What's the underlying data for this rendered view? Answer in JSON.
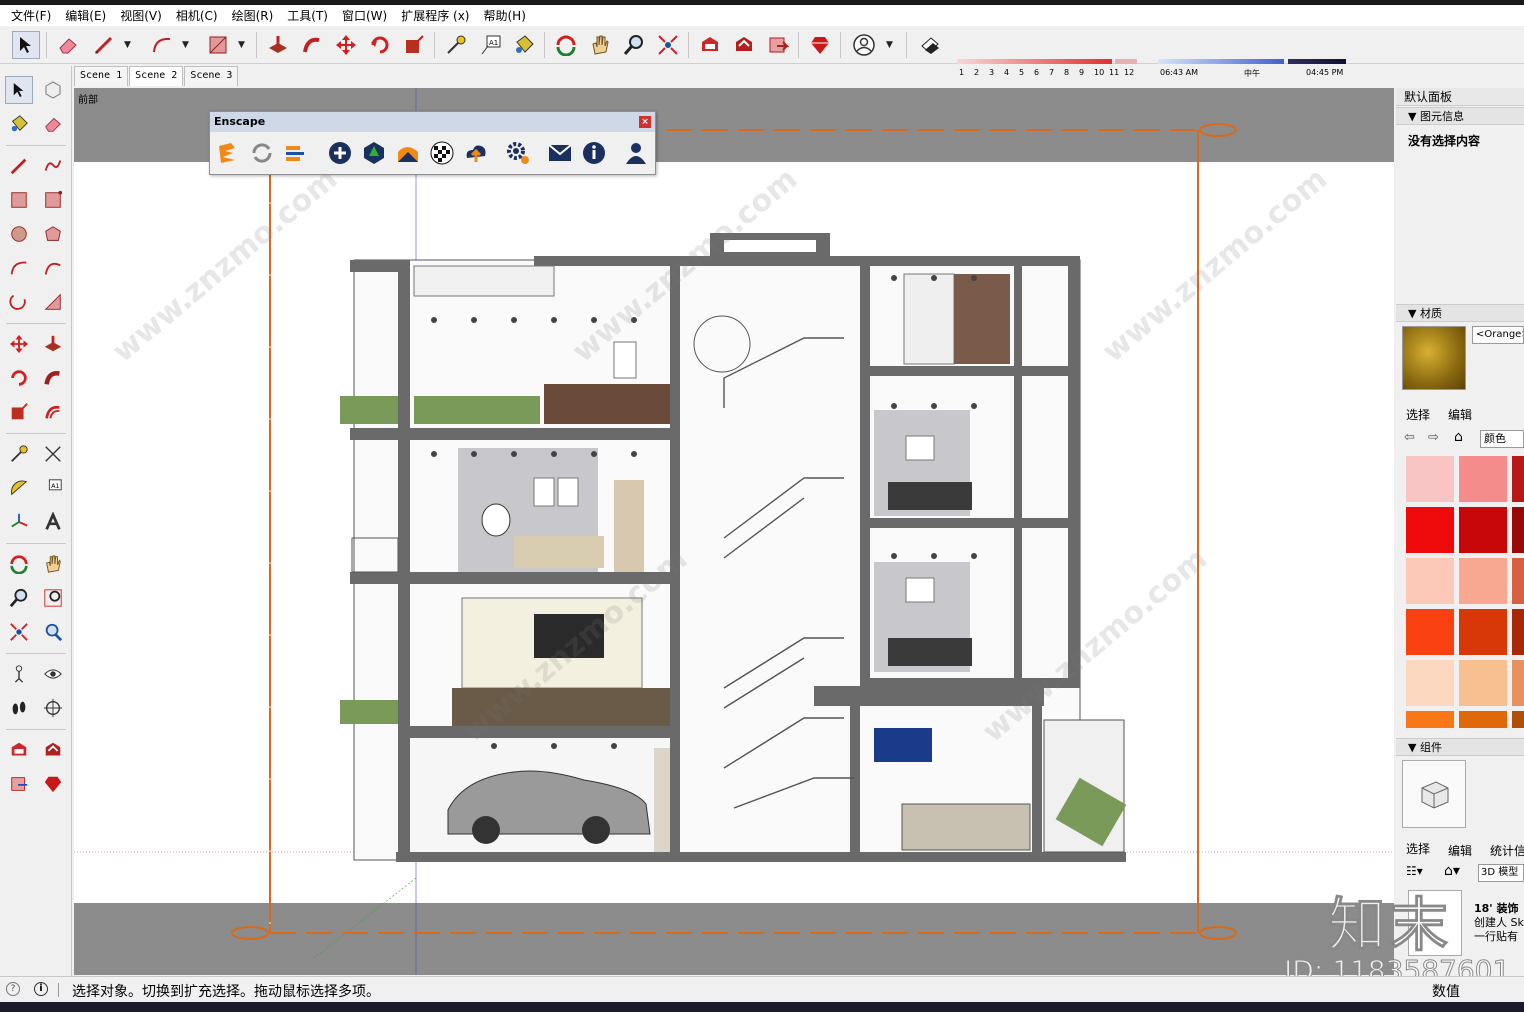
{
  "menu": [
    "文件(F)",
    "编辑(E)",
    "视图(V)",
    "相机(C)",
    "绘图(R)",
    "工具(T)",
    "窗口(W)",
    "扩展程序 (x)",
    "帮助(H)"
  ],
  "shadow": {
    "months": [
      "1",
      "2",
      "3",
      "4",
      "5",
      "6",
      "7",
      "8",
      "9",
      "10",
      "11",
      "12"
    ],
    "time_start": "06:43 AM",
    "time_mid": "中午",
    "time_end": "04:45 PM"
  },
  "scenes": [
    "Scene 1",
    "Scene 2",
    "Scene 3"
  ],
  "active_scene": "Scene 2",
  "view_label": "前部",
  "enscape": {
    "title": "Enscape"
  },
  "right_panel": {
    "default_tray": "默认面板",
    "entity_info": "图元信息",
    "no_selection": "没有选择内容",
    "materials": "材质",
    "material_name": "<Orange>",
    "select_tab": "选择",
    "edit_tab": "编辑",
    "color_dropdown": "颜色",
    "components": "组件",
    "comp_select": "选择",
    "comp_edit": "编辑",
    "comp_stats": "统计信",
    "comp_model": "3D 模型",
    "comp_item_title": "18' 装饰",
    "comp_item_author": "创建人 Sk",
    "comp_item_desc": "一行贴有"
  },
  "swatch_colors": [
    "#f9c4c4",
    "#f48c8c",
    "#b81818",
    "#ee0a0a",
    "#c80808",
    "#980808",
    "#fcc8b8",
    "#f8a890",
    "#d86040",
    "#f84010",
    "#d83808",
    "#a82808",
    "#fcd8c0",
    "#f8c090",
    "#e89060",
    "#f87818",
    "#e06808",
    "#b05008"
  ],
  "status": {
    "message": "选择对象。切换到扩充选择。拖动鼠标选择多项。",
    "value_label": "数值"
  },
  "watermark": {
    "brand": "知末",
    "id_label": "ID: 1183587601"
  },
  "colors": {
    "section_orange": "#d86a1c",
    "accent_red": "#cc2020"
  }
}
